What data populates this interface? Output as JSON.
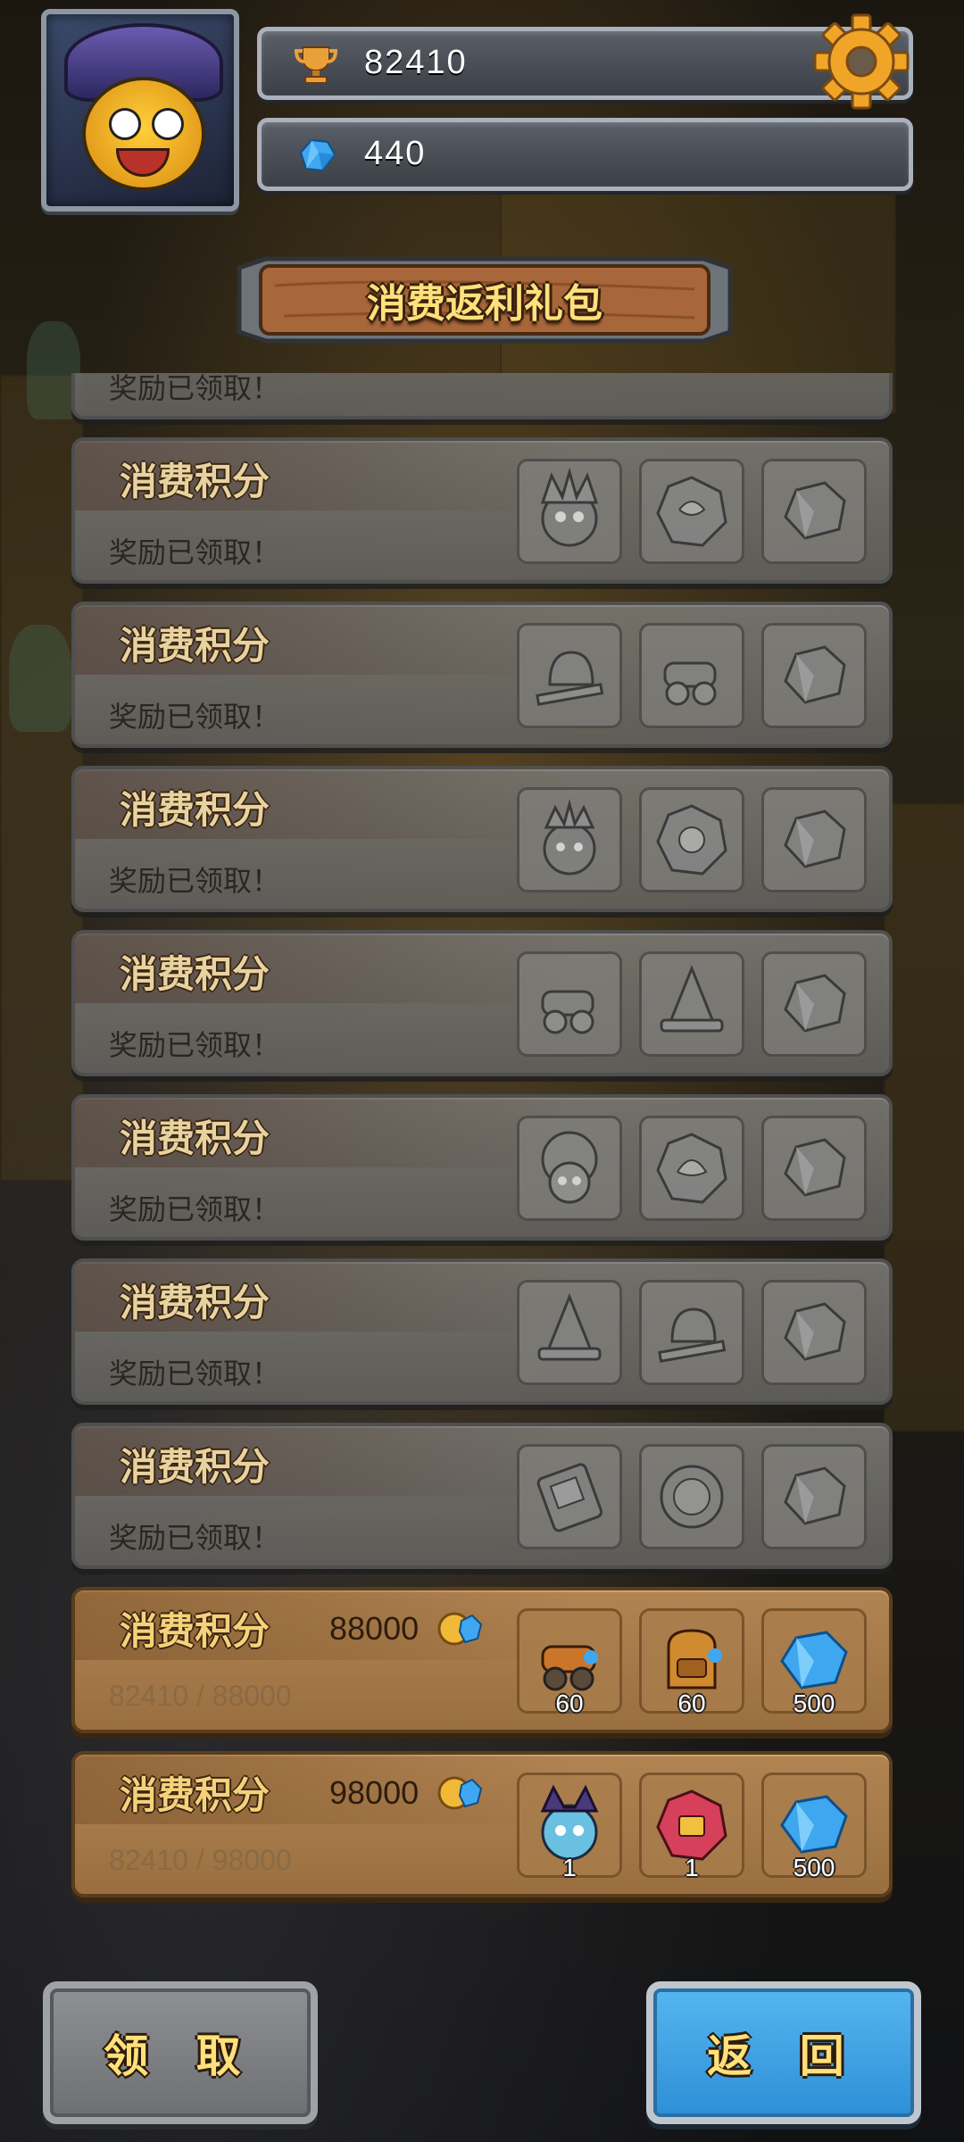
{
  "colors": {
    "gold_text": "#f5d17a",
    "claim_button": "#7d7f83",
    "back_button": "#3aa3e6",
    "active_row": "#a87a4a",
    "claimed_row": "#6e6c68"
  },
  "header": {
    "trophy_value": "82410",
    "gem_value": "440",
    "trophy_icon": "trophy-icon",
    "gem_icon": "gem-icon",
    "settings_icon": "gear-icon"
  },
  "banner": {
    "title": "消费返利礼包"
  },
  "rows": [
    {
      "title": "",
      "status": "奖励已领取！",
      "state": "claimed",
      "rewards": []
    },
    {
      "title": "消费积分",
      "status": "奖励已领取！",
      "state": "claimed",
      "rewards": [
        {
          "icon": "hero-spiky-icon"
        },
        {
          "icon": "hero-shard-icon"
        },
        {
          "icon": "ore-icon"
        }
      ]
    },
    {
      "title": "消费积分",
      "status": "奖励已领取！",
      "state": "claimed",
      "rewards": [
        {
          "icon": "helmet-sword-icon"
        },
        {
          "icon": "cannon-icon"
        },
        {
          "icon": "ore-icon"
        }
      ]
    },
    {
      "title": "消费积分",
      "status": "奖励已领取！",
      "state": "claimed",
      "rewards": [
        {
          "icon": "hero-crown-icon"
        },
        {
          "icon": "hero-shard-icon"
        },
        {
          "icon": "ore-icon"
        }
      ]
    },
    {
      "title": "消费积分",
      "status": "奖励已领取！",
      "state": "claimed",
      "rewards": [
        {
          "icon": "cannon-icon"
        },
        {
          "icon": "wizard-hat-icon"
        },
        {
          "icon": "ore-icon"
        }
      ]
    },
    {
      "title": "消费积分",
      "status": "奖励已领取！",
      "state": "claimed",
      "rewards": [
        {
          "icon": "hero-tree-icon"
        },
        {
          "icon": "hero-shard-icon"
        },
        {
          "icon": "ore-icon"
        }
      ]
    },
    {
      "title": "消费积分",
      "status": "奖励已领取！",
      "state": "claimed",
      "rewards": [
        {
          "icon": "wizard-hat-icon"
        },
        {
          "icon": "helmet-sword-icon"
        },
        {
          "icon": "ore-icon"
        }
      ]
    },
    {
      "title": "消费积分",
      "status": "奖励已领取！",
      "state": "claimed",
      "rewards": [
        {
          "icon": "book-icon"
        },
        {
          "icon": "coin-token-icon"
        },
        {
          "icon": "ore-icon"
        }
      ]
    },
    {
      "title": "消费积分",
      "target": "88000",
      "status": "82410 / 88000",
      "state": "active",
      "progress": 0.936,
      "rewards": [
        {
          "icon": "cannon-icon",
          "qty": "60"
        },
        {
          "icon": "backpack-icon",
          "qty": "60"
        },
        {
          "icon": "gem-icon",
          "qty": "500"
        }
      ]
    },
    {
      "title": "消费积分",
      "target": "98000",
      "status": "82410 / 98000",
      "state": "active",
      "progress": 0.841,
      "rewards": [
        {
          "icon": "hero-dragon-icon",
          "qty": "1"
        },
        {
          "icon": "hero-shard-icon",
          "qty": "1"
        },
        {
          "icon": "gem-icon",
          "qty": "500"
        }
      ]
    }
  ],
  "buttons": {
    "claim": "领 取",
    "back": "返 回"
  }
}
